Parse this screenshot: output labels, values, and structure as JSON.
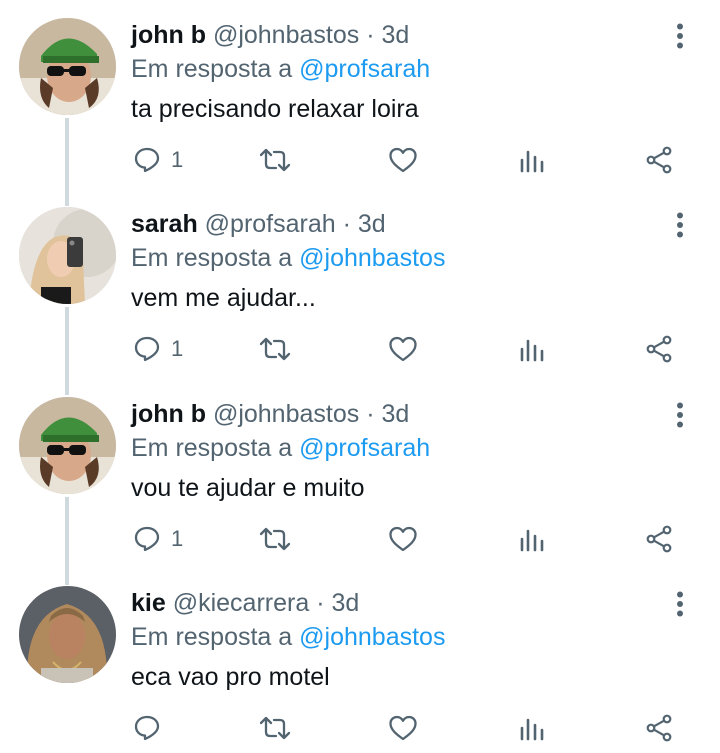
{
  "tweets": [
    {
      "name": "john b",
      "handle": "@johnbastos",
      "sep": "·",
      "time": "3d",
      "replying_prefix": "Em resposta a",
      "replying_to": "@profsarah",
      "text": "ta precisando relaxar loira",
      "reply_count": "1"
    },
    {
      "name": "sarah",
      "handle": "@profsarah",
      "sep": "·",
      "time": "3d",
      "replying_prefix": "Em resposta a",
      "replying_to": "@johnbastos",
      "text": "vem me ajudar...",
      "reply_count": "1"
    },
    {
      "name": "john b",
      "handle": "@johnbastos",
      "sep": "·",
      "time": "3d",
      "replying_prefix": "Em resposta a",
      "replying_to": "@profsarah",
      "text": "vou te ajudar e muito",
      "reply_count": "1"
    },
    {
      "name": "kie",
      "handle": "@kiecarrera",
      "sep": "·",
      "time": "3d",
      "replying_prefix": "Em resposta a",
      "replying_to": "@johnbastos",
      "text": "eca vao pro motel",
      "reply_count": ""
    }
  ],
  "icons": {
    "reply": "reply-icon",
    "retweet": "retweet-icon",
    "like": "heart-icon",
    "stats": "stats-icon",
    "share": "share-icon",
    "more": "more-vertical-icon"
  },
  "colors": {
    "text": "#0f1419",
    "secondary": "#536471",
    "mention": "#1d9bf0",
    "thread_line": "#cfd9de"
  }
}
